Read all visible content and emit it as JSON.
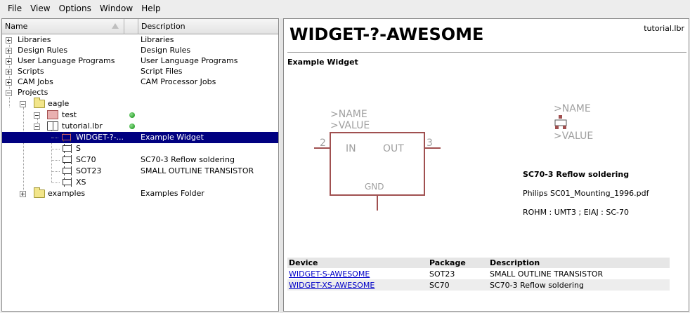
{
  "menu": [
    "File",
    "View",
    "Options",
    "Window",
    "Help"
  ],
  "tree_header": {
    "name": "Name",
    "description": "Description"
  },
  "tree": [
    {
      "label": "Libraries",
      "desc": "Libraries"
    },
    {
      "label": "Design Rules",
      "desc": "Design Rules"
    },
    {
      "label": "User Language Programs",
      "desc": "User Language Programs"
    },
    {
      "label": "Scripts",
      "desc": "Script Files"
    },
    {
      "label": "CAM Jobs",
      "desc": "CAM Processor Jobs"
    },
    {
      "label": "Projects",
      "desc": ""
    },
    {
      "label": "eagle",
      "desc": ""
    },
    {
      "label": "test",
      "desc": ""
    },
    {
      "label": "tutorial.lbr",
      "desc": ""
    },
    {
      "label": "WIDGET-?-...",
      "desc": "Example Widget"
    },
    {
      "label": "S",
      "desc": ""
    },
    {
      "label": "SC70",
      "desc": "SC70-3 Reflow soldering"
    },
    {
      "label": "SOT23",
      "desc": "SMALL OUTLINE TRANSISTOR"
    },
    {
      "label": "XS",
      "desc": ""
    },
    {
      "label": "examples",
      "desc": "Examples Folder"
    }
  ],
  "detail": {
    "title": "WIDGET-?-AWESOME",
    "file": "tutorial.lbr",
    "subtitle": "Example Widget",
    "symbol": {
      "name": ">NAME",
      "value": ">VALUE",
      "pin_in": "IN",
      "pin_out": "OUT",
      "pin_gnd": "GND",
      "pin_num_left": "2",
      "pin_num_right": "3"
    },
    "package": {
      "name": ">NAME",
      "value": ">VALUE"
    },
    "package_title": "SC70-3 Reflow soldering",
    "package_line1": "Philips SC01_Mounting_1996.pdf",
    "package_line2": "ROHM : UMT3 ; EIAJ : SC-70",
    "devices_header": {
      "device": "Device",
      "package": "Package",
      "description": "Description"
    },
    "devices": [
      {
        "device": "WIDGET-S-AWESOME",
        "package": "SOT23",
        "description": "SMALL OUTLINE TRANSISTOR"
      },
      {
        "device": "WIDGET-XS-AWESOME",
        "package": "SC70",
        "description": "SC70-3 Reflow soldering"
      }
    ]
  },
  "colors": {
    "selection": "#000080",
    "symbol": "#a05050",
    "link": "#0000c8",
    "status_dot": "#0a8a0a"
  }
}
